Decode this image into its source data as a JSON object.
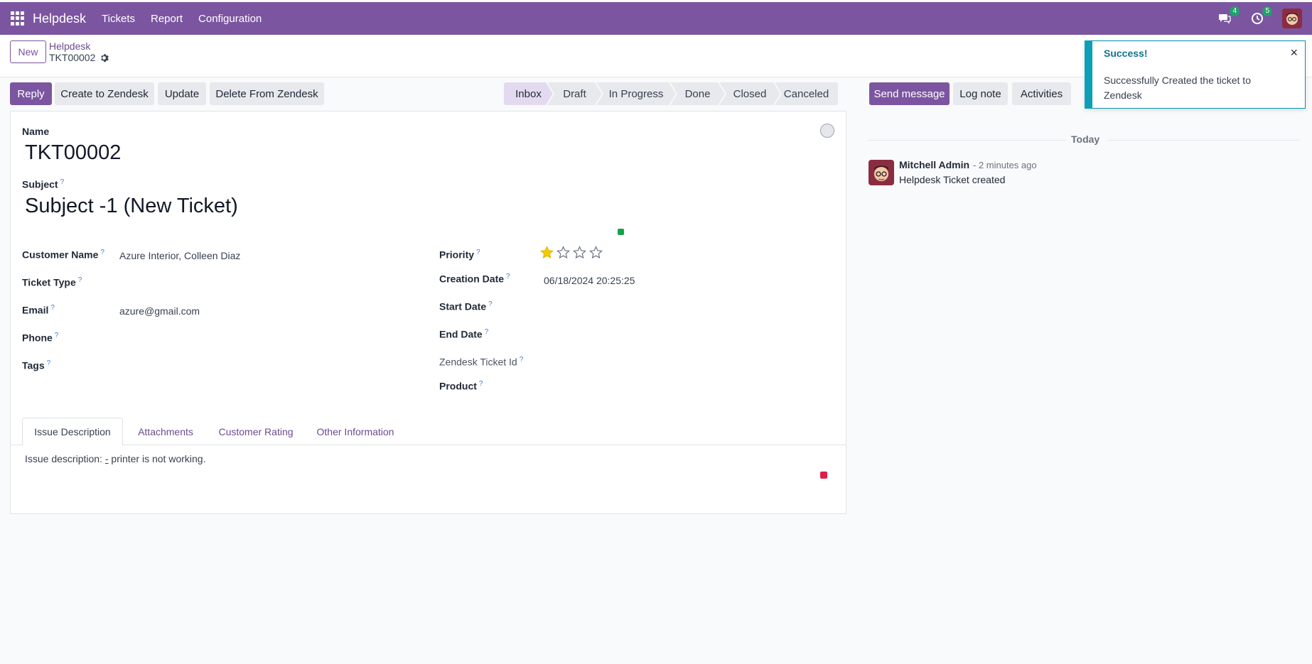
{
  "navbar": {
    "brand": "Helpdesk",
    "menu": [
      "Tickets",
      "Report",
      "Configuration"
    ],
    "messages_badge": "4",
    "activities_badge": "5",
    "color": "#7c55a0"
  },
  "control": {
    "new_label": "New",
    "breadcrumb_parent": "Helpdesk",
    "breadcrumb_current": "TKT00002"
  },
  "actions": {
    "reply": "Reply",
    "create_zendesk": "Create to Zendesk",
    "update": "Update",
    "delete_zendesk": "Delete From Zendesk"
  },
  "stages": [
    "Inbox",
    "Draft",
    "In Progress",
    "Done",
    "Closed",
    "Canceled"
  ],
  "active_stage": "Inbox",
  "form": {
    "name_label": "Name",
    "name_value": "TKT00002",
    "subject_label": "Subject",
    "subject_value": "Subject -1 (New Ticket)",
    "help_mark": "?",
    "customer_label": "Customer Name",
    "customer_value": "Azure Interior, Colleen Diaz",
    "ticket_type_label": "Ticket Type",
    "email_label": "Email",
    "email_value": "azure@gmail.com",
    "phone_label": "Phone",
    "tags_label": "Tags",
    "priority_label": "Priority",
    "priority_value": 1,
    "priority_max": 5,
    "creation_label": "Creation Date",
    "creation_value": "06/18/2024 20:25:25",
    "start_label": "Start Date",
    "end_label": "End Date",
    "zendesk_label": "Zendesk Ticket Id",
    "product_label": "Product"
  },
  "tabs": [
    "Issue Description",
    "Attachments",
    "Customer Rating",
    "Other Information"
  ],
  "issue": {
    "prefix": "Issue description: ",
    "dash": "-",
    "rest": " printer is not working."
  },
  "chatter": {
    "send_message": "Send message",
    "log_note": "Log note",
    "activities": "Activities",
    "today": "Today",
    "author": "Mitchell Admin",
    "time": "- 2 minutes ago",
    "body": "Helpdesk Ticket created"
  },
  "toast": {
    "title": "Success!",
    "body": "Successfully Created the ticket to Zendesk",
    "close": "×"
  }
}
